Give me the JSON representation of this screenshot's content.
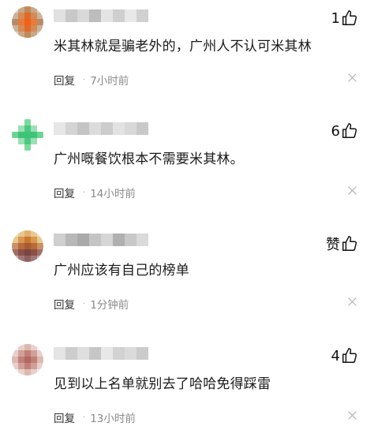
{
  "comments": [
    {
      "text": "米其林就是骗老外的，广州人不认可米其林",
      "reply_label": "回复",
      "dot": "·",
      "time": "7小时前",
      "likes": "1",
      "avatar_colors": [
        "#d9d0c6",
        "#c8a888",
        "#c08a5a",
        "#c8a888",
        "#d9d0c6",
        "#c9b49a",
        "#d48a58",
        "#e06a2a",
        "#d48a58",
        "#c9b49a",
        "#b88a6a",
        "#e87a3a",
        "#f0601a",
        "#e87a3a",
        "#b88a6a",
        "#c9b49a",
        "#d48a58",
        "#e06a2a",
        "#d48a58",
        "#c9b49a",
        "#d9d0c6",
        "#c8a888",
        "#c08a5a",
        "#c8a888",
        "#d9d0c6"
      ],
      "name_colors": [
        "#e0e0e0",
        "#c8c8c8",
        "#d8d8d8",
        "#bdbdbd",
        "#e4e4e4",
        "#cfcfcf",
        "#e8e8e8",
        "#d0d0d0"
      ]
    },
    {
      "text": "广州嘅餐饮根本不需要米其林。",
      "reply_label": "回复",
      "dot": "·",
      "time": "14小时前",
      "likes": "6",
      "avatar_colors": [
        "#ffffff",
        "#ffffff",
        "#7ed9a0",
        "#ffffff",
        "#ffffff",
        "#ffffff",
        "#9ce0b4",
        "#4cc982",
        "#9ce0b4",
        "#ffffff",
        "#6cd394",
        "#3fc378",
        "#3fc378",
        "#3fc378",
        "#6cd394",
        "#ffffff",
        "#9ce0b4",
        "#4cc982",
        "#9ce0b4",
        "#ffffff",
        "#ffffff",
        "#ffffff",
        "#7ed9a0",
        "#ffffff",
        "#ffffff"
      ],
      "name_colors": [
        "#e6e6e6",
        "#d4d4d4",
        "#c4c4c4",
        "#dcdcdc",
        "#cccccc",
        "#e2e2e2",
        "#d8d8d8",
        "#c9c9c9"
      ]
    },
    {
      "text": "广州应该有自己的榜单",
      "reply_label": "回复",
      "dot": "·",
      "time": "1分钟前",
      "likes": "赞",
      "avatar_colors": [
        "#f0e0c0",
        "#e8c890",
        "#e0b070",
        "#e8c890",
        "#f0e0c0",
        "#e8c890",
        "#d89850",
        "#c87830",
        "#d89850",
        "#e8c890",
        "#c89068",
        "#b86a38",
        "#a85a30",
        "#b86a38",
        "#c89068",
        "#a0706a",
        "#8a5048",
        "#7a4440",
        "#8a5048",
        "#a0706a",
        "#c8a8a0",
        "#a07878",
        "#906060",
        "#a07878",
        "#c8a8a0"
      ],
      "name_colors": [
        "#cfcfcf",
        "#b8b8b8",
        "#aaaaaa",
        "#c4c4c4",
        "#d6d6d6",
        "#b0b0b0",
        "#c8c8c8",
        "#dadada"
      ]
    },
    {
      "text": "见到以上名单就别去了哈哈免得踩雷",
      "reply_label": "回复",
      "dot": "·",
      "time": "13小时前",
      "likes": "4",
      "avatar_colors": [
        "#f4ecea",
        "#e8d0cc",
        "#dcb8b0",
        "#e8d0cc",
        "#f4ecea",
        "#e8d0cc",
        "#d0a098",
        "#c08078",
        "#d0a098",
        "#e8d0cc",
        "#dcb8b0",
        "#c08078",
        "#b06860",
        "#c08078",
        "#dcb8b0",
        "#e8d0cc",
        "#d0a098",
        "#c08078",
        "#d0a098",
        "#e8d0cc",
        "#f4ecea",
        "#e8d0cc",
        "#dcb8b0",
        "#e8d0cc",
        "#f4ecea"
      ],
      "name_colors": [
        "#e4e4e4",
        "#cdcdcd",
        "#dedede",
        "#c6c6c6",
        "#e8e8e8",
        "#d2d2d2",
        "#dbdbdb",
        "#cbcbcb"
      ]
    }
  ]
}
